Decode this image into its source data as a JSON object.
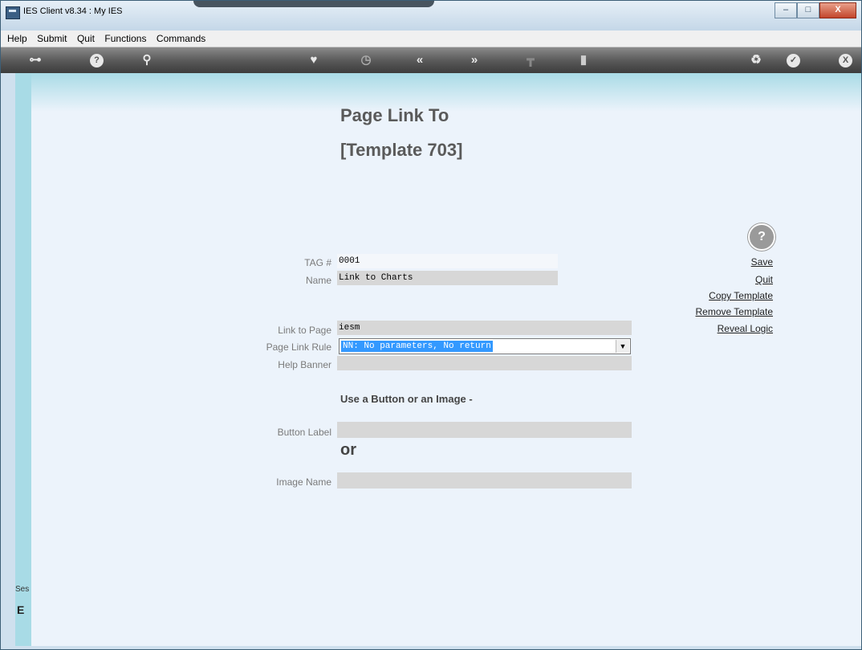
{
  "window": {
    "title": "IES Client v8.34 : My IES",
    "minimize": "–",
    "maximize": "□",
    "close": "X"
  },
  "menu": [
    "Help",
    "Submit",
    "Quit",
    "Functions",
    "Commands"
  ],
  "toolbar": {
    "key": "⊶",
    "help": "?",
    "search": "⚲",
    "heart": "♥",
    "clock": "◷",
    "back": "«",
    "forward": "»",
    "stand": "┳",
    "tile": "▮",
    "recycle": "♻",
    "check": "✓",
    "close": "X"
  },
  "page": {
    "title": "Page Link To",
    "subtitle": "[Template 703]"
  },
  "form": {
    "tag_label": "TAG #",
    "tag_value": "0001",
    "name_label": "Name",
    "name_value": "Link to Charts",
    "link_label": "Link to Page",
    "link_value": "iesm",
    "rule_label": "Page Link Rule",
    "rule_value": "NN: No parameters, No return",
    "banner_label": "Help Banner",
    "banner_value": "",
    "use_text": "Use a Button or an Image -",
    "button_label": "Button Label",
    "button_value": "",
    "or_text": "or",
    "image_label": "Image Name",
    "image_value": ""
  },
  "actions": {
    "help": "?",
    "save": "Save",
    "quit": "Quit",
    "copy": "Copy Template",
    "remove": "Remove Template",
    "reveal": "Reveal Logic"
  },
  "session": {
    "tab": "Ses",
    "icon": "E"
  }
}
